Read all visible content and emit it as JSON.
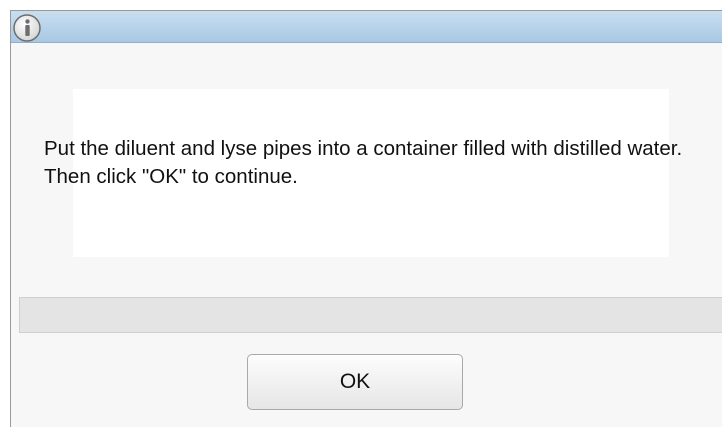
{
  "dialog": {
    "icon": "info-icon",
    "message": "Put the diluent and lyse pipes into a container filled with distilled water. Then click \"OK\" to continue.",
    "progress": 0,
    "ok_label": "OK"
  },
  "colors": {
    "titlebar": "#b7d2ea",
    "background": "#f7f7f7",
    "panel": "#ffffff",
    "progress_track": "#e4e4e4"
  }
}
